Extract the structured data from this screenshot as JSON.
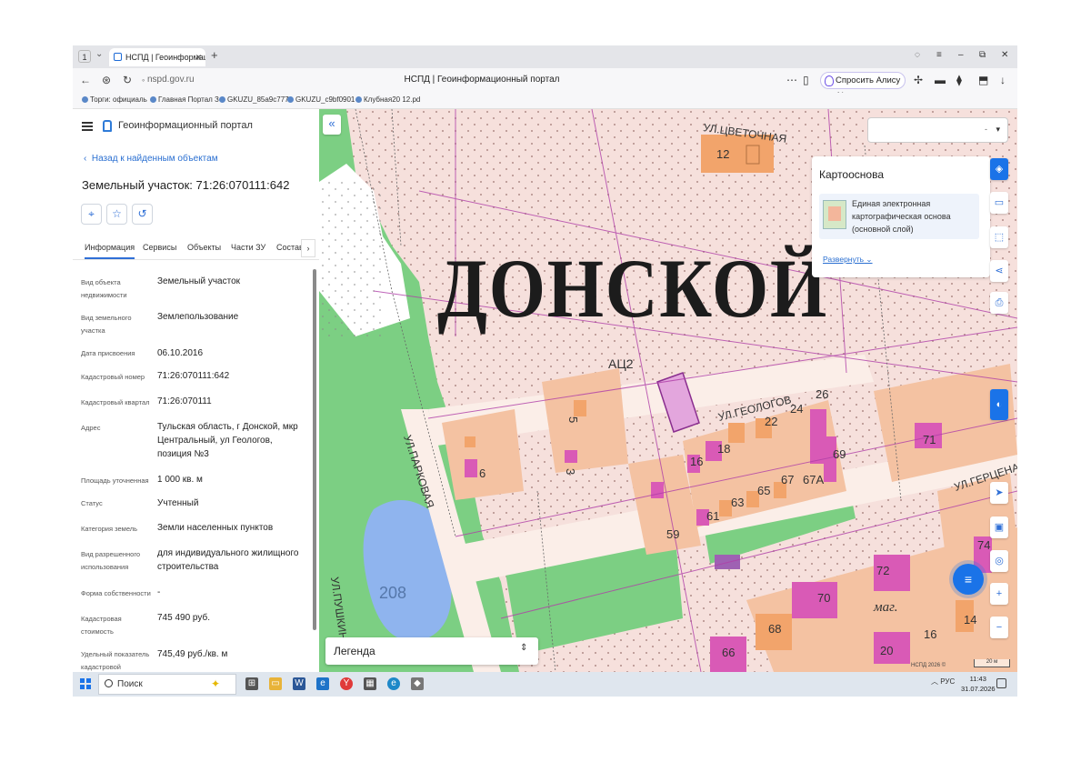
{
  "browser": {
    "tab_count": "1",
    "tab_title": "НСПД | Геоинформаци",
    "url": "nspd.gov.ru",
    "page_title": "НСПД | Геоинформационный портал",
    "alice_label": "Спросить Алису AI",
    "bookmarks": [
      "Торги: официаль",
      "Главная Портал З",
      "GKUZU_85a9c777",
      "GKUZU_c9bf0901",
      "Клубная20 12.pd"
    ]
  },
  "panel": {
    "app_title": "Геоинформационный портал",
    "back_label": "Назад к найденным объектам",
    "parcel_title": "Земельный участок: 71:26:070111:642",
    "tabs": [
      "Информация",
      "Сервисы",
      "Объекты",
      "Части ЗУ",
      "Состав"
    ],
    "fields": [
      {
        "label": "Вид объекта недвижимости",
        "value": "Земельный участок"
      },
      {
        "label": "Вид земельного участка",
        "value": "Землепользование"
      },
      {
        "label": "Дата присвоения",
        "value": "06.10.2016"
      },
      {
        "label": "Кадастровый номер",
        "value": "71:26:070111:642"
      },
      {
        "label": "Кадастровый квартал",
        "value": "71:26:070111"
      },
      {
        "label": "Адрес",
        "value": "Тульская область, г Донской, мкр Центральный, ул Геологов, позиция №3"
      },
      {
        "label": "Площадь уточненная",
        "value": "1 000 кв. м"
      },
      {
        "label": "Статус",
        "value": "Учтенный"
      },
      {
        "label": "Категория земель",
        "value": "Земли населенных пунктов"
      },
      {
        "label": "Вид разрешенного использования",
        "value": "для индивидуального жилищного строительства"
      },
      {
        "label": "Форма собственности",
        "value": "-"
      },
      {
        "label": "Кадастровая стоимость",
        "value": "745 490 руб."
      },
      {
        "label": "Удельный показатель кадастровой",
        "value": "745,49 руб./кв. м"
      }
    ]
  },
  "map": {
    "basemap_title": "Картооснова",
    "basemap_item": "Единая электронная картографическая основа (основной слой)",
    "basemap_expand": "Развернуть",
    "legend_label": "Легенда",
    "copyright": "НСПД 2026 ©",
    "scale": "20 м",
    "labels": {
      "city": "ДОНСКОЙ",
      "street_tsvetochnaya": "УЛ.ЦВЕТОЧНАЯ",
      "street_geologov": "УЛ.ГЕОЛОГОВ",
      "street_parkovaya": "УЛ.ПАРКОВАЯ",
      "street_gertsena": "УЛ.ГЕРЦЕНА",
      "street_pushkina": "УЛ.ПУШКИН",
      "acz": "АЦ2",
      "water": "208",
      "shop": "маг.",
      "numbers": [
        "12",
        "5",
        "3",
        "6",
        "16",
        "18",
        "22",
        "24",
        "26",
        "69",
        "67А",
        "67",
        "65",
        "63",
        "61",
        "59",
        "71",
        "74",
        "72",
        "70",
        "68",
        "66",
        "20",
        "16",
        "14"
      ]
    },
    "colors": {
      "background": "#f6e0dc",
      "park": "#7ccf83",
      "building": "#f2a46b",
      "parcel": "#d95ab6",
      "water": "#8fb4ee",
      "road": "#fbeee8"
    }
  },
  "taskbar": {
    "search_label": "Поиск",
    "lang": "РУС",
    "time": "11:43",
    "date": "31.07.2026"
  }
}
